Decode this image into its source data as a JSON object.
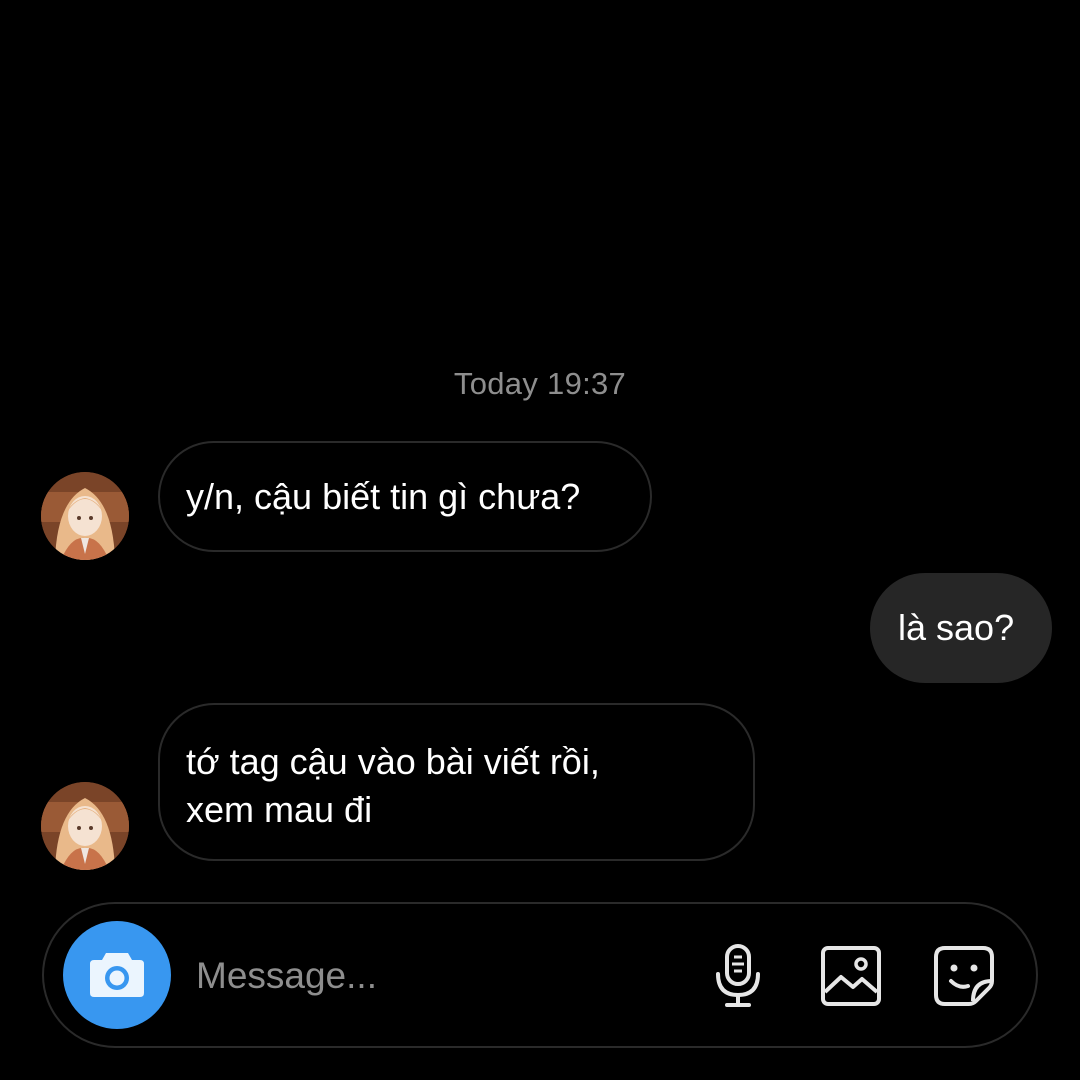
{
  "thread": {
    "timestamp": "Today 19:37",
    "messages": [
      {
        "from": "them",
        "text": "y/n, cậu biết tin gì chưa?"
      },
      {
        "from": "me",
        "text": "là sao?"
      },
      {
        "from": "them",
        "lines": [
          "tớ tag cậu vào bài viết rồi,",
          "xem mau đi"
        ]
      }
    ]
  },
  "composer": {
    "placeholder": "Message...",
    "icons": [
      "camera-icon",
      "microphone-icon",
      "image-gallery-icon",
      "sticker-icon"
    ]
  },
  "colors": {
    "background": "#000000",
    "incoming_border": "#2a2a2a",
    "outgoing_bubble": "#262626",
    "accent": "#3897f0",
    "muted_text": "#8e8e8e"
  }
}
